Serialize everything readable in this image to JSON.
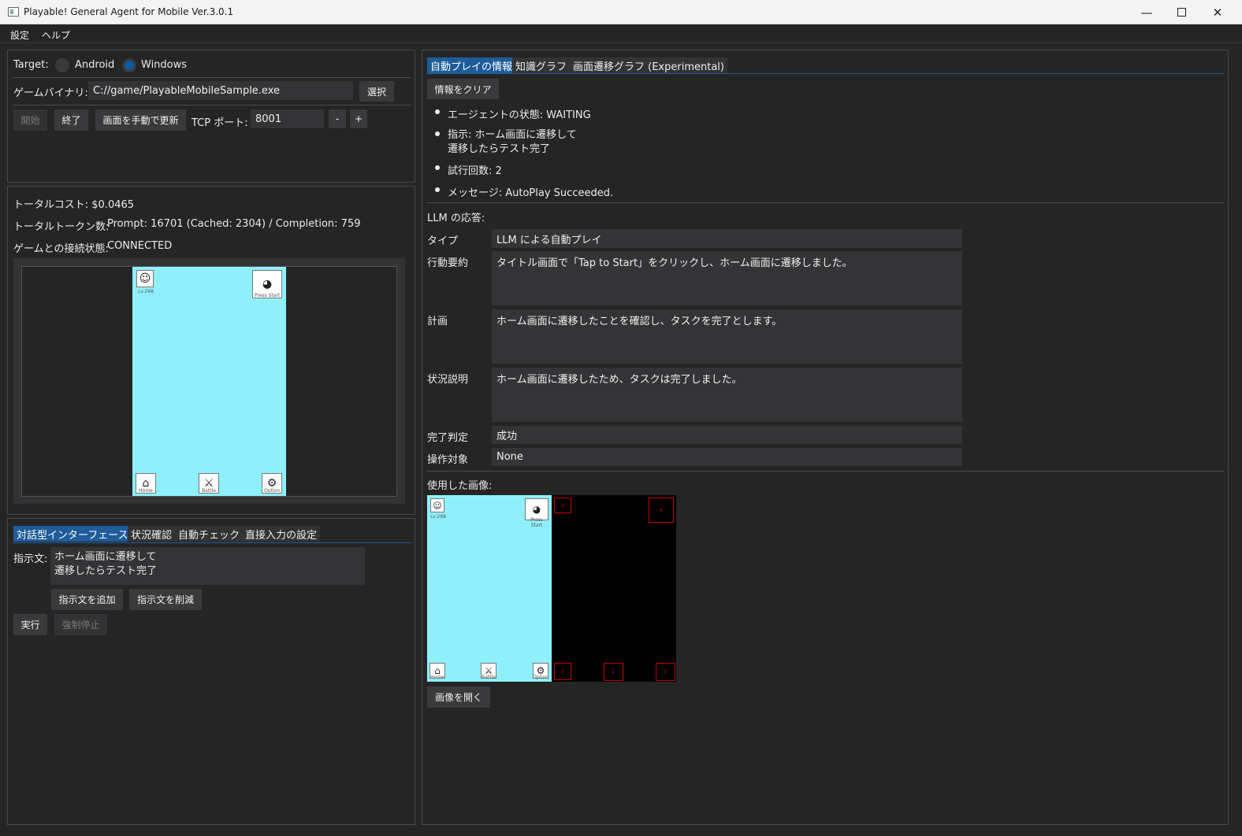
{
  "window": {
    "title": "Playable! General Agent for Mobile Ver.3.0.1",
    "minimize_icon": "minimize-icon",
    "maximize_icon": "maximize-icon",
    "close_icon": "close-icon"
  },
  "menu": {
    "items": [
      "設定",
      "ヘルプ"
    ]
  },
  "target": {
    "label": "Target:",
    "options": [
      "Android",
      "Windows"
    ],
    "selected": "Windows"
  },
  "binary": {
    "label": "ゲームバイナリ:",
    "value": "C://game/PlayableMobileSample.exe",
    "select_button": "選択"
  },
  "controls": {
    "start": "開始",
    "end": "終了",
    "refresh": "画面を手動で更新",
    "port_label": "TCP ポート:",
    "port_value": "8001",
    "minus": "-",
    "plus": "+"
  },
  "stats": {
    "cost_label": "トータルコスト:",
    "cost_value": "$0.0465",
    "tokens_label": "トータルトークン数:",
    "tokens_value": "Prompt: 16701 (Cached: 2304) / Completion: 759",
    "connection_label": "ゲームとの接続状態:",
    "connection_value": "CONNECTED"
  },
  "game": {
    "top_left_icon": "bear-icon",
    "top_left_caption": "Lv.268",
    "top_right_icon": "bowl-icon",
    "top_right_caption": "Press Start",
    "bottom_icons": [
      {
        "icon": "home-icon",
        "caption": "Home"
      },
      {
        "icon": "swords-icon",
        "caption": "Battle"
      },
      {
        "icon": "gear-icon",
        "caption": "Option"
      }
    ],
    "background_color": "#8ff0fb"
  },
  "left_tabs": {
    "items": [
      "対話型インターフェース",
      "状況確認",
      "自動チェック",
      "直接入力の設定"
    ],
    "active": 0
  },
  "instruction": {
    "label": "指示文:",
    "lines": [
      "ホーム画面に遷移して",
      "遷移したらテスト完了"
    ],
    "add_button": "指示文を追加",
    "remove_button": "指示文を削減",
    "run_button": "実行",
    "stop_button": "強制停止"
  },
  "right_tabs": {
    "items": [
      "自動プレイの情報",
      "知識グラフ",
      "画面遷移グラフ (Experimental)"
    ],
    "active": 0
  },
  "info": {
    "clear_button": "情報をクリア",
    "bullets": [
      "エージェントの状態: WAITING",
      "指示: ホーム画面に遷移して\n遷移したらテスト完了",
      "試行回数: 2",
      "メッセージ: AutoPlay Succeeded."
    ]
  },
  "llm": {
    "heading": "LLM の応答:",
    "rows": [
      {
        "label": "タイプ",
        "value": "LLM による自動プレイ"
      },
      {
        "label": "行動要約",
        "value": "タイトル画面で「Tap to Start」をクリックし、ホーム画面に遷移しました。"
      },
      {
        "label": "計画",
        "value": "ホーム画面に遷移したことを確認し、タスクを完了とします。"
      },
      {
        "label": "状況説明",
        "value": "ホーム画面に遷移したため、タスクは完了しました。"
      },
      {
        "label": "完了判定",
        "value": "成功"
      },
      {
        "label": "操作対象",
        "value": "None"
      }
    ]
  },
  "used_image": {
    "heading": "使用した画像:",
    "open_button": "画像を開く",
    "box_labels": [
      "2",
      "4",
      "0",
      "1",
      "3"
    ],
    "box_color": "#cc0000"
  }
}
